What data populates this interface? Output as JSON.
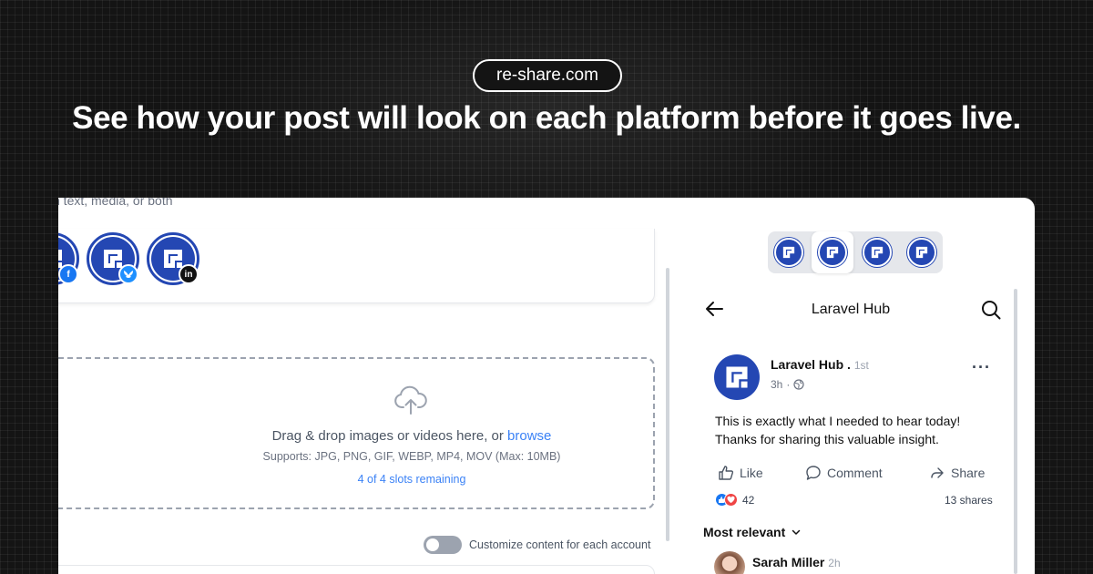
{
  "brand": {
    "site": "re-share.com"
  },
  "headline": "See how your post will look on each platform before it goes live.",
  "composer": {
    "cut_hint": "n text, media, or both",
    "accounts": [
      {
        "name": "facebook-account",
        "platform_icon": "facebook-icon",
        "color": "#1877f2"
      },
      {
        "name": "bluesky-account",
        "platform_icon": "bluesky-icon",
        "color": "#1e90ff"
      },
      {
        "name": "linkedin-account",
        "platform_icon": "linkedin-icon",
        "color": "#111111",
        "badge_text": "in"
      }
    ],
    "dropzone": {
      "prompt": "Drag & drop images or videos here, or ",
      "browse": "browse",
      "supports": "Supports: JPG, PNG, GIF, WEBP, MP4, MOV (Max: 10MB)",
      "slots": "4 of 4 slots remaining"
    },
    "customize_toggle": {
      "label": "Customize content for each account",
      "on": false
    }
  },
  "preview": {
    "tabs": [
      "account-1",
      "account-2",
      "account-3",
      "account-4"
    ],
    "active_tab": 1,
    "header_title": "Laravel Hub",
    "post": {
      "author": "Laravel Hub",
      "separator": ".",
      "degree": "1st",
      "time": "3h",
      "text_line1": "This is exactly what I needed to hear today!",
      "text_line2": "Thanks for sharing this valuable insight.",
      "actions": {
        "like": "Like",
        "comment": "Comment",
        "share": "Share"
      },
      "reaction_count": "42",
      "shares": "13 shares"
    },
    "sort_label": "Most relevant",
    "comment": {
      "author": "Sarah Miller",
      "time": "2h"
    }
  },
  "colors": {
    "brand_blue": "#2447b3",
    "link_blue": "#3b82f6",
    "background": "#141414"
  }
}
